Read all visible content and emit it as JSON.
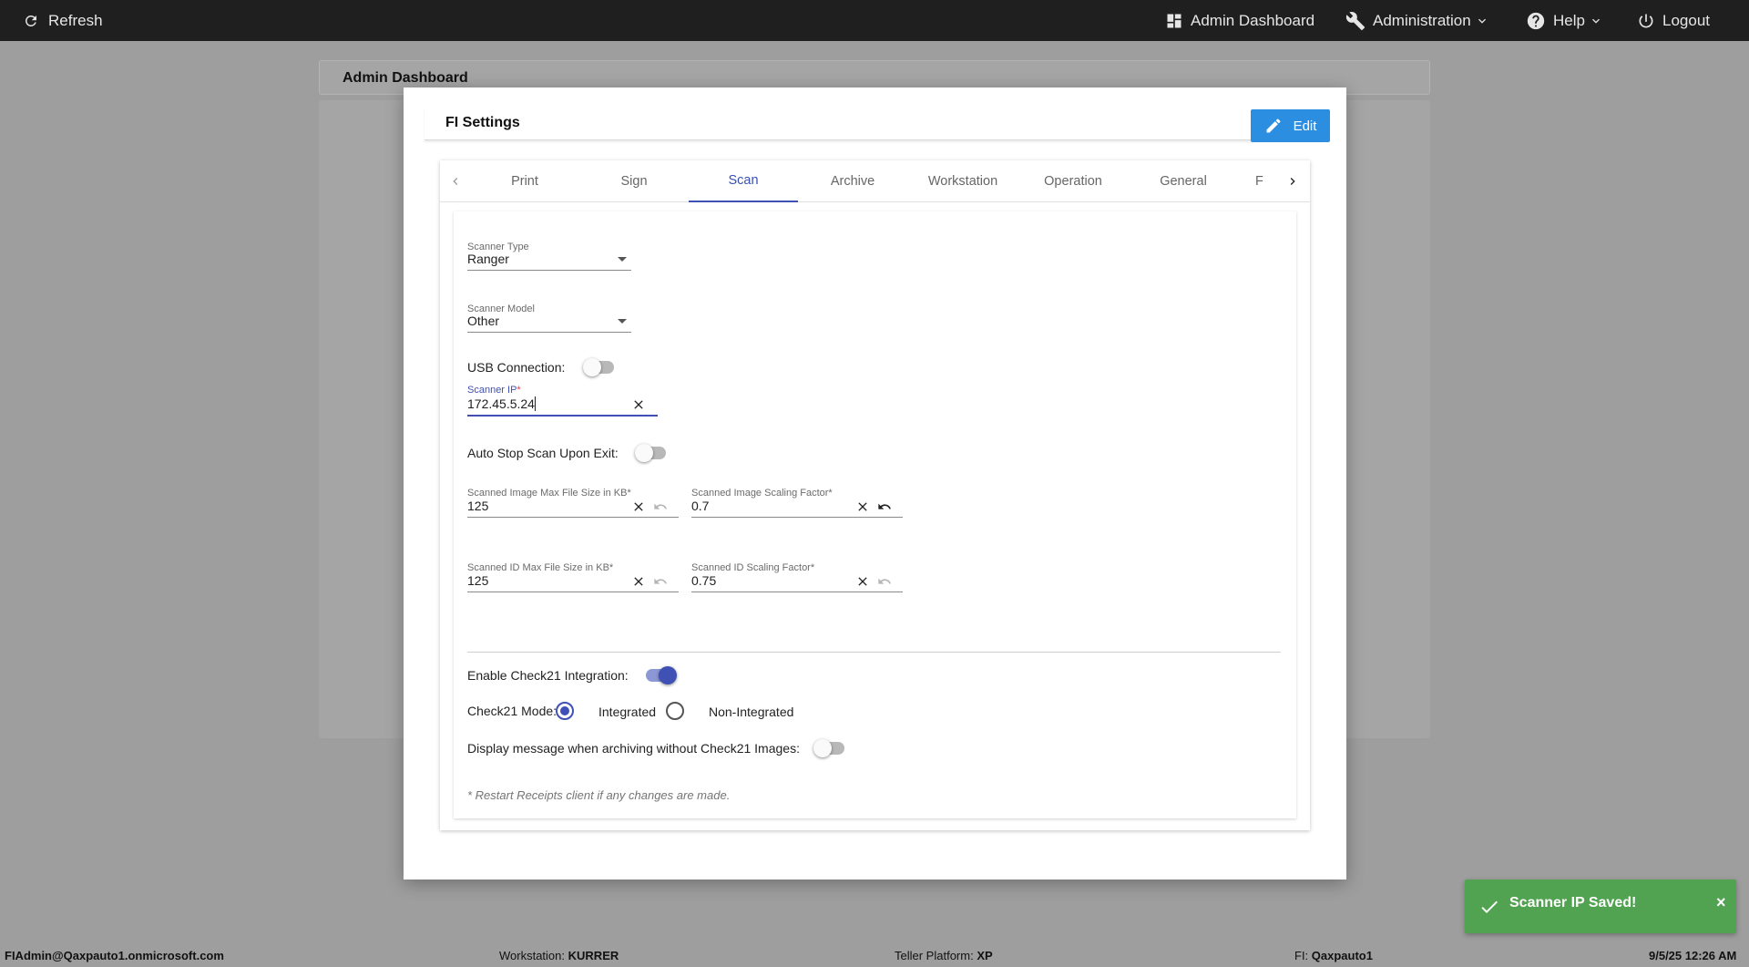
{
  "topbar": {
    "refresh_label": "Refresh",
    "admin_dashboard_label": "Admin Dashboard",
    "administration_label": "Administration",
    "help_label": "Help",
    "logout_label": "Logout"
  },
  "background": {
    "card_title": "Admin Dashboard"
  },
  "modal": {
    "title": "FI Settings",
    "edit_label": "Edit",
    "tabs": [
      "Print",
      "Sign",
      "Scan",
      "Archive",
      "Workstation",
      "Operation",
      "General",
      "F"
    ],
    "active_tab": "Scan"
  },
  "scan": {
    "scanner_type": {
      "label": "Scanner Type",
      "value": "Ranger"
    },
    "scanner_model": {
      "label": "Scanner Model",
      "value": "Other"
    },
    "usb_connection": {
      "label": "USB Connection:",
      "on": false
    },
    "scanner_ip": {
      "label": "Scanner IP",
      "required": "*",
      "value": "172.45.5.24"
    },
    "auto_stop": {
      "label": "Auto Stop Scan Upon Exit:",
      "on": false
    },
    "image_max_size": {
      "label": "Scanned Image Max File Size in KB*",
      "value": "125"
    },
    "image_scaling": {
      "label": "Scanned Image Scaling Factor*",
      "value": "0.7"
    },
    "id_max_size": {
      "label": "Scanned ID Max File Size in KB*",
      "value": "125"
    },
    "id_scaling": {
      "label": "Scanned ID Scaling Factor*",
      "value": "0.75"
    },
    "check21_enable": {
      "label": "Enable Check21 Integration:",
      "on": true
    },
    "check21_mode": {
      "label": "Check21 Mode:",
      "options": [
        "Integrated",
        "Non-Integrated"
      ],
      "selected": "Integrated"
    },
    "display_message": {
      "label": "Display message when archiving without Check21 Images:",
      "on": false
    },
    "note": "* Restart Receipts client if any changes are made."
  },
  "toast": {
    "message": "Scanner IP Saved!",
    "close": "×"
  },
  "footer": {
    "user": "FIAdmin@Qaxpauto1.onmicrosoft.com",
    "workstation_label": "Workstation:",
    "workstation_value": "KURRER",
    "platform_label": "Teller Platform:",
    "platform_value": "XP",
    "fi_label": "FI:",
    "fi_value": "Qaxpauto1",
    "datetime": "9/5/25 12:26 AM"
  },
  "colors": {
    "topbar": "#1f1f1f",
    "accent": "#3f51b5",
    "edit_button": "#2c8ee0",
    "toast": "#51a351"
  }
}
